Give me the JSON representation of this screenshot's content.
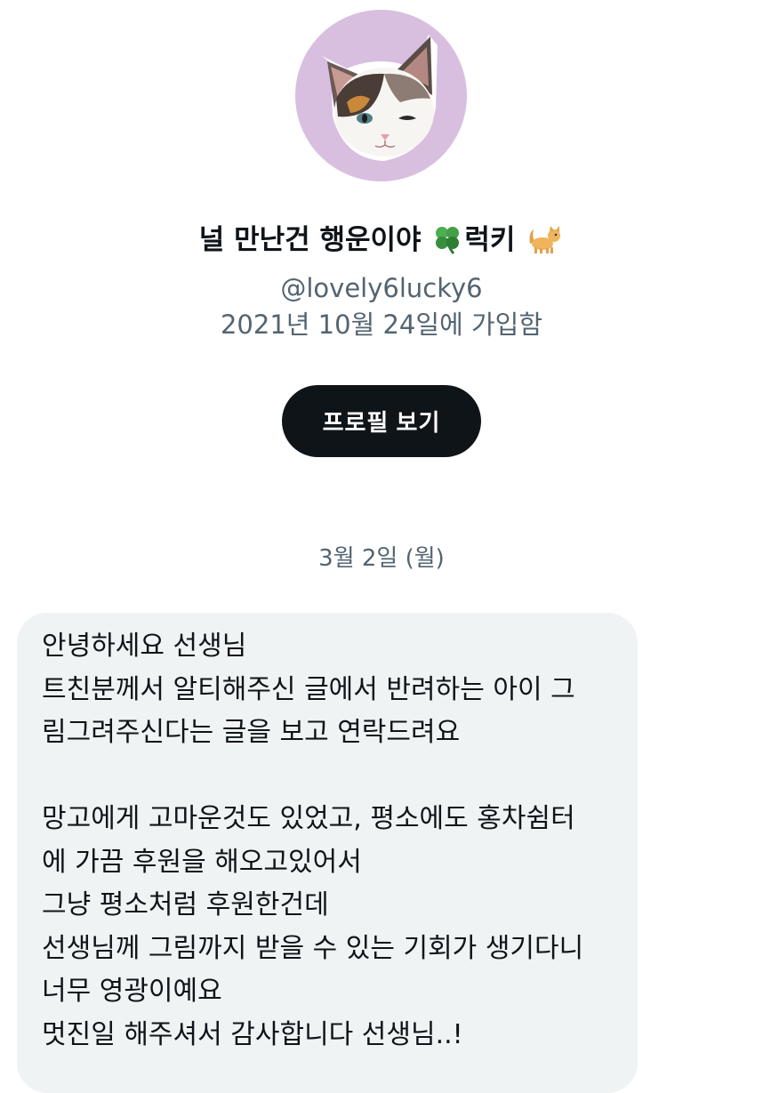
{
  "profile": {
    "avatar_icon": "cat-face-avatar",
    "avatar_bg": "#d8bfe0",
    "name_part1": "널 만난건 행운이야",
    "name_emoji1": "four-leaf-clover",
    "name_part2": "럭키",
    "name_emoji2": "cat",
    "handle": "@lovely6lucky6",
    "joined": "2021년 10월 24일에 가입함",
    "view_profile_label": "프로필 보기"
  },
  "conversation": {
    "date_label": "3월 2일 (월)",
    "message": {
      "lines": [
        "안녕하세요 선생님",
        "트친분께서 알티해주신 글에서 반려하는 아이 그",
        "림그려주신다는 글을 보고 연락드려요",
        "",
        "망고에게 고마운것도 있었고, 평소에도 홍차쉼터",
        "에 가끔 후원을 해오고있어서",
        "그냥 평소처럼 후원한건데",
        "선생님께 그림까지 받을 수 있는 기회가 생기다니",
        "너무 영광이예요",
        "멋진일 해주셔서 감사합니다 선생님..!"
      ]
    }
  },
  "colors": {
    "text_primary": "#0f1419",
    "text_secondary": "#536471",
    "button_bg": "#0f1419",
    "bubble_bg": "#eff3f4"
  }
}
